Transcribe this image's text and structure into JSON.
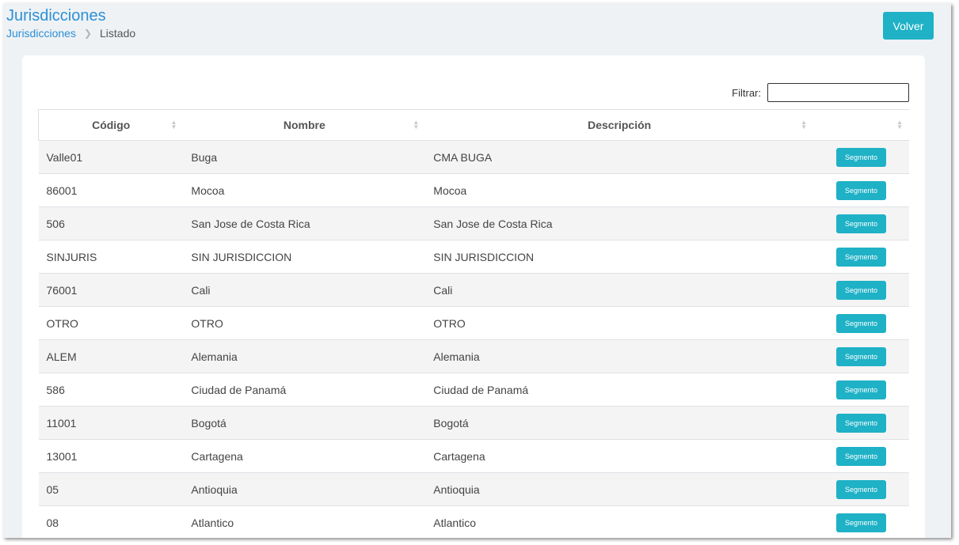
{
  "header": {
    "title": "Jurisdicciones",
    "breadcrumb": {
      "link": "Jurisdicciones",
      "current": "Listado"
    },
    "back_button": "Volver"
  },
  "filter": {
    "label": "Filtrar:",
    "value": ""
  },
  "table": {
    "columns": [
      "Código",
      "Nombre",
      "Descripción",
      ""
    ],
    "rows": [
      {
        "codigo": "Valle01",
        "nombre": "Buga",
        "descripcion": "CMA BUGA",
        "action": "Segmento"
      },
      {
        "codigo": "86001",
        "nombre": "Mocoa",
        "descripcion": "Mocoa",
        "action": "Segmento"
      },
      {
        "codigo": "506",
        "nombre": "San Jose de Costa Rica",
        "descripcion": "San Jose de Costa Rica",
        "action": "Segmento"
      },
      {
        "codigo": "SINJURIS",
        "nombre": "SIN JURISDICCION",
        "descripcion": "SIN JURISDICCION",
        "action": "Segmento"
      },
      {
        "codigo": "76001",
        "nombre": "Cali",
        "descripcion": "Cali",
        "action": "Segmento"
      },
      {
        "codigo": "OTRO",
        "nombre": "OTRO",
        "descripcion": "OTRO",
        "action": "Segmento"
      },
      {
        "codigo": "ALEM",
        "nombre": "Alemania",
        "descripcion": "Alemania",
        "action": "Segmento"
      },
      {
        "codigo": "586",
        "nombre": "Ciudad de Panamá",
        "descripcion": "Ciudad de Panamá",
        "action": "Segmento"
      },
      {
        "codigo": "11001",
        "nombre": "Bogotá",
        "descripcion": "Bogotá",
        "action": "Segmento"
      },
      {
        "codigo": "13001",
        "nombre": "Cartagena",
        "descripcion": "Cartagena",
        "action": "Segmento"
      },
      {
        "codigo": "05",
        "nombre": "Antioquia",
        "descripcion": "Antioquia",
        "action": "Segmento"
      },
      {
        "codigo": "08",
        "nombre": "Atlantico",
        "descripcion": "Atlantico",
        "action": "Segmento"
      }
    ]
  },
  "colors": {
    "accent": "#1fb1c6",
    "link": "#2d8fd6",
    "background": "#eef2f4"
  }
}
